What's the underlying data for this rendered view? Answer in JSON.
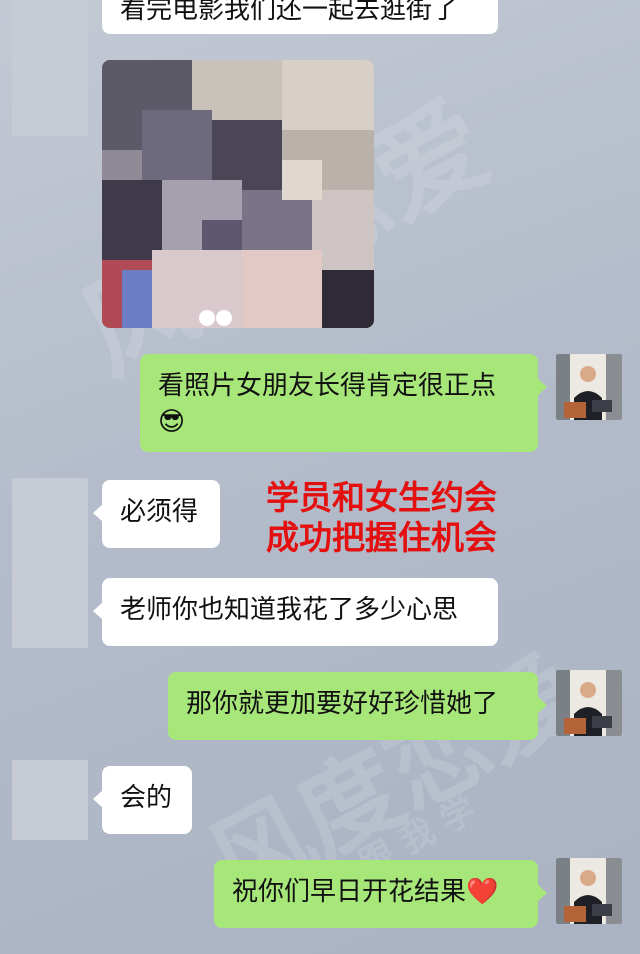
{
  "messages": {
    "top_partial": "看完电影我们还一起去逛街了",
    "m1": "看照片女朋友长得肯定很正点",
    "m1_emoji": "😎",
    "m2": "必须得",
    "m3": "老师你也知道我花了多少心思",
    "m4": "那你就更加要好好珍惜她了",
    "m5": "会的",
    "m6": "祝你们早日开花结果",
    "m6_emoji": "❤️"
  },
  "annotation": {
    "line1": "学员和女生约会",
    "line2": "成功把握住机会"
  },
  "watermark": {
    "brand": "风度恋爱",
    "slogan": "学 跟 我 学"
  },
  "colors": {
    "bubble_sent": "#a7e77a",
    "bubble_received": "#ffffff",
    "annotation": "#e3100f"
  }
}
